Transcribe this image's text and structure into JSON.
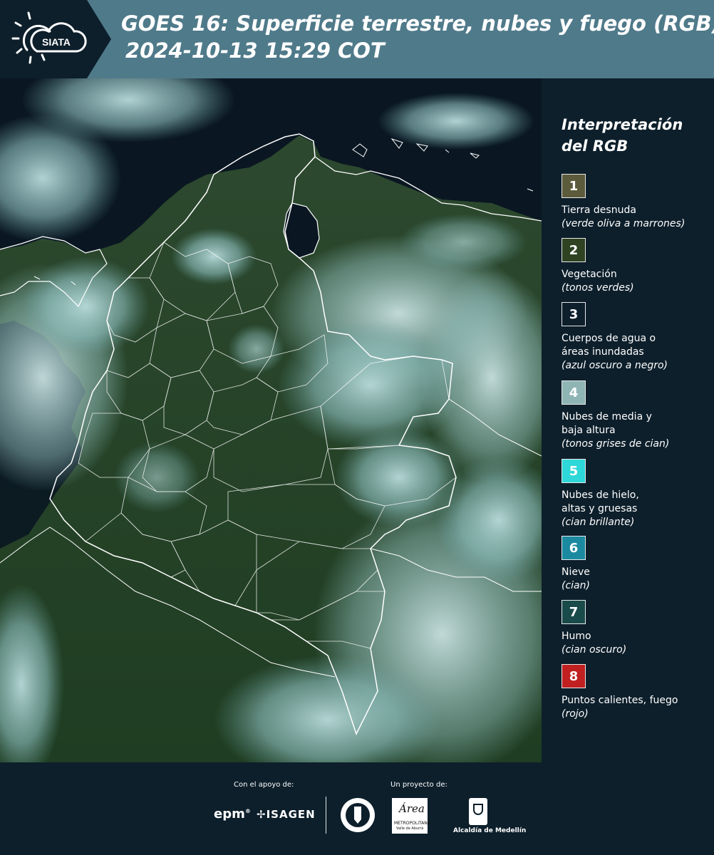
{
  "header": {
    "logo_text": "SIATA",
    "title_line1": "GOES 16: Superficie terrestre, nubes y fuego (RGB)",
    "title_line2": "2024-10-13 15:29 COT",
    "panel_color": "#4f7a8a",
    "dark_color": "#0d1f2b"
  },
  "legend": {
    "title_line1": "Interpretación",
    "title_line2": "del RGB",
    "items": [
      {
        "number": "1",
        "color": "#5c5c3c",
        "label_line1": "Tierra desnuda",
        "label_line2": "",
        "sub": "(verde oliva a marrones)"
      },
      {
        "number": "2",
        "color": "#2f4323",
        "label_line1": "Vegetación",
        "label_line2": "",
        "sub": "(tonos verdes)"
      },
      {
        "number": "3",
        "color": "#0d1f2b",
        "label_line1": "Cuerpos de agua o",
        "label_line2": "áreas inundadas",
        "sub": "(azul oscuro a negro)"
      },
      {
        "number": "4",
        "color": "#8fb4b4",
        "label_line1": "Nubes de media y",
        "label_line2": "baja altura",
        "sub": "(tonos grises de cian)"
      },
      {
        "number": "5",
        "color": "#2fd8d8",
        "label_line1": "Nubes de hielo,",
        "label_line2": "altas y gruesas",
        "sub": "(cian brillante)"
      },
      {
        "number": "6",
        "color": "#1b8aa0",
        "label_line1": "Nieve",
        "label_line2": "",
        "sub": "(cian)"
      },
      {
        "number": "7",
        "color": "#1a4b4b",
        "label_line1": "Humo",
        "label_line2": "",
        "sub": "(cian oscuro)"
      },
      {
        "number": "8",
        "color": "#c02020",
        "label_line1": "Puntos calientes, fuego",
        "label_line2": "",
        "sub": "(rojo)"
      }
    ]
  },
  "footer": {
    "support_label": "Con el apoyo de:",
    "project_label": "Un proyecto de:",
    "sponsor1": "epm",
    "sponsor2": "ISAGEN",
    "area_line1": "Área",
    "area_line2": "METROPOLITANA",
    "area_line3": "Valle de Aburrá",
    "alcaldia": "Alcaldía de Medellín"
  }
}
